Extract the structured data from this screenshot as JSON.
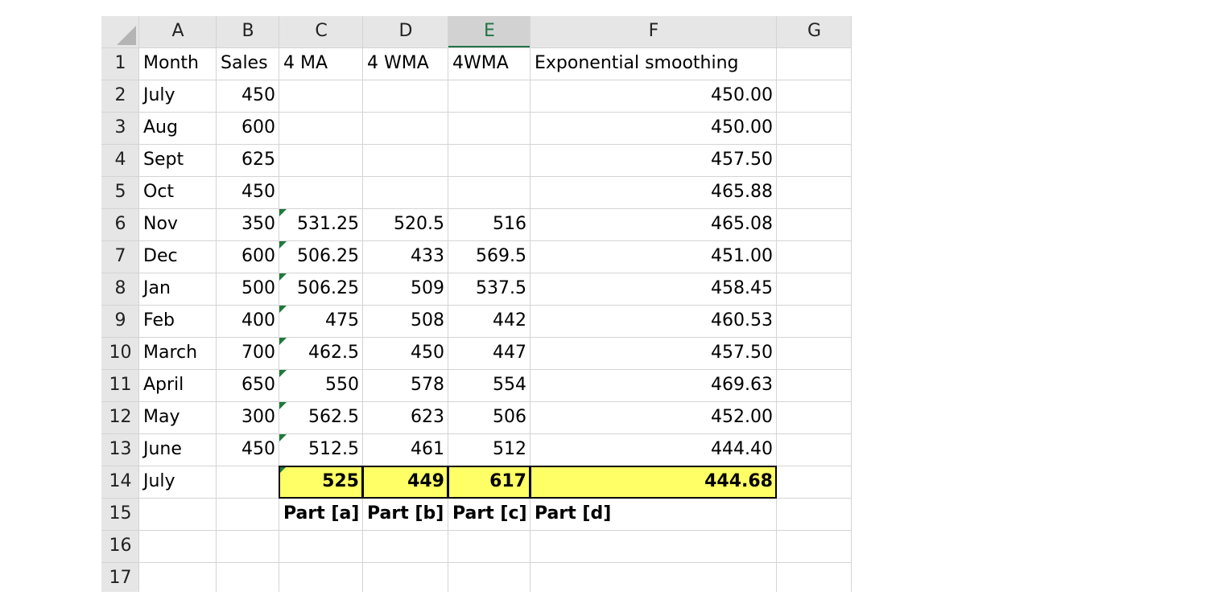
{
  "sheet": {
    "columns": [
      "A",
      "B",
      "C",
      "D",
      "E",
      "F",
      "G"
    ],
    "selected_column": "E",
    "rows": [
      [
        "Month",
        "Sales",
        "4 MA",
        "4 WMA",
        "4WMA",
        "Exponential smoothing",
        ""
      ],
      [
        "July",
        "450",
        "",
        "",
        "",
        "450.00",
        ""
      ],
      [
        "Aug",
        "600",
        "",
        "",
        "",
        "450.00",
        ""
      ],
      [
        "Sept",
        "625",
        "",
        "",
        "",
        "457.50",
        ""
      ],
      [
        "Oct",
        "450",
        "",
        "",
        "",
        "465.88",
        ""
      ],
      [
        "Nov",
        "350",
        "531.25",
        "520.5",
        "516",
        "465.08",
        ""
      ],
      [
        "Dec",
        "600",
        "506.25",
        "433",
        "569.5",
        "451.00",
        ""
      ],
      [
        "Jan",
        "500",
        "506.25",
        "509",
        "537.5",
        "458.45",
        ""
      ],
      [
        "Feb",
        "400",
        "475",
        "508",
        "442",
        "460.53",
        ""
      ],
      [
        "March",
        "700",
        "462.5",
        "450",
        "447",
        "457.50",
        ""
      ],
      [
        "April",
        "650",
        "550",
        "578",
        "554",
        "469.63",
        ""
      ],
      [
        "May",
        "300",
        "562.5",
        "623",
        "506",
        "452.00",
        ""
      ],
      [
        "June",
        "450",
        "512.5",
        "461",
        "512",
        "444.40",
        ""
      ],
      [
        "July",
        "",
        "525",
        "449",
        "617",
        "444.68",
        ""
      ],
      [
        "",
        "",
        "Part [a]",
        "Part [b]",
        "Part [c]",
        "Part [d]",
        ""
      ],
      [
        "",
        "",
        "",
        "",
        "",
        "",
        ""
      ],
      [
        "",
        "",
        "",
        "",
        "",
        "",
        ""
      ]
    ],
    "row_numbers": [
      "1",
      "2",
      "3",
      "4",
      "5",
      "6",
      "7",
      "8",
      "9",
      "10",
      "11",
      "12",
      "13",
      "14",
      "15",
      "16",
      "17"
    ],
    "highlight_color": "#ffff66",
    "selected_header_color": "#217346"
  }
}
